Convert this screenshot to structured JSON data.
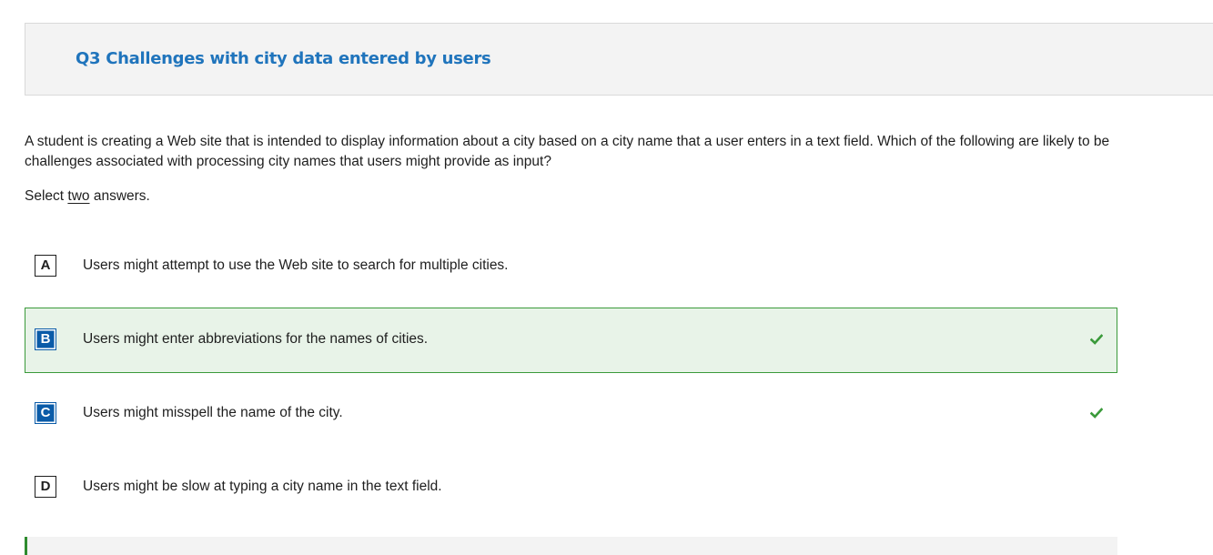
{
  "header": {
    "title": "Q3 Challenges with city data entered by users"
  },
  "question": {
    "text": "A student is creating a Web site that is intended to display information about a city based on a city name that a user enters in a text field. Which of the following are likely to be challenges associated with processing city names that users might provide as input?",
    "instruction_prefix": "Select ",
    "instruction_emphasis": "two",
    "instruction_suffix": " answers."
  },
  "options": [
    {
      "letter": "A",
      "text": "Users might attempt to use the Web site to search for multiple cities.",
      "selected": false,
      "correct": false
    },
    {
      "letter": "B",
      "text": "Users might enter abbreviations for the names of cities.",
      "selected": true,
      "correct": true
    },
    {
      "letter": "C",
      "text": "Users might misspell the name of the city.",
      "selected": false,
      "correct": true
    },
    {
      "letter": "D",
      "text": "Users might be slow at typing a city name in the text field.",
      "selected": false,
      "correct": false
    }
  ],
  "colors": {
    "title": "#1f74bc",
    "selected_bg": "#e8f3e8",
    "selected_border": "#3a9a3a",
    "chosen_letter_bg": "#0a5ba8",
    "check": "#3a9a3a"
  },
  "icons": {
    "check": "checkmark-icon"
  }
}
